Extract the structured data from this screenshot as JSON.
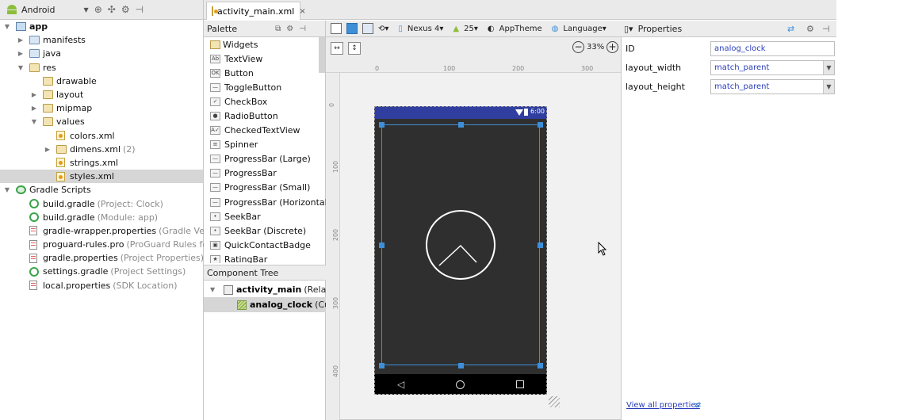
{
  "project_panel": {
    "view_label": "Android",
    "tree": [
      {
        "label": "app",
        "hint": "",
        "level": 0,
        "arrow": "down",
        "icon": "module",
        "bold": true
      },
      {
        "label": "manifests",
        "hint": "",
        "level": 1,
        "arrow": "right",
        "icon": "folder"
      },
      {
        "label": "java",
        "hint": "",
        "level": 1,
        "arrow": "right",
        "icon": "folder"
      },
      {
        "label": "res",
        "hint": "",
        "level": 1,
        "arrow": "down",
        "icon": "folder-res"
      },
      {
        "label": "drawable",
        "hint": "",
        "level": 2,
        "arrow": "",
        "icon": "folder-res"
      },
      {
        "label": "layout",
        "hint": "",
        "level": 2,
        "arrow": "right",
        "icon": "folder-res"
      },
      {
        "label": "mipmap",
        "hint": "",
        "level": 2,
        "arrow": "right",
        "icon": "folder-res"
      },
      {
        "label": "values",
        "hint": "",
        "level": 2,
        "arrow": "down",
        "icon": "folder-res"
      },
      {
        "label": "colors.xml",
        "hint": "",
        "level": 3,
        "arrow": "",
        "icon": "xml"
      },
      {
        "label": "dimens.xml",
        "hint": "(2)",
        "level": 3,
        "arrow": "right",
        "icon": "folder-res"
      },
      {
        "label": "strings.xml",
        "hint": "",
        "level": 3,
        "arrow": "",
        "icon": "xml"
      },
      {
        "label": "styles.xml",
        "hint": "",
        "level": 3,
        "arrow": "",
        "icon": "xml",
        "selected": true
      },
      {
        "label": "Gradle Scripts",
        "hint": "",
        "level": 0,
        "arrow": "down",
        "icon": "gradle-root"
      },
      {
        "label": "build.gradle",
        "hint": "(Project: Clock)",
        "level": 1,
        "arrow": "",
        "icon": "gradle"
      },
      {
        "label": "build.gradle",
        "hint": "(Module: app)",
        "level": 1,
        "arrow": "",
        "icon": "gradle"
      },
      {
        "label": "gradle-wrapper.properties",
        "hint": "(Gradle Version)",
        "level": 1,
        "arrow": "",
        "icon": "props"
      },
      {
        "label": "proguard-rules.pro",
        "hint": "(ProGuard Rules for app)",
        "level": 1,
        "arrow": "",
        "icon": "props"
      },
      {
        "label": "gradle.properties",
        "hint": "(Project Properties)",
        "level": 1,
        "arrow": "",
        "icon": "props"
      },
      {
        "label": "settings.gradle",
        "hint": "(Project Settings)",
        "level": 1,
        "arrow": "",
        "icon": "gradle"
      },
      {
        "label": "local.properties",
        "hint": "(SDK Location)",
        "level": 1,
        "arrow": "",
        "icon": "props"
      }
    ]
  },
  "editor_tab": {
    "label": "activity_main.xml",
    "close": "×"
  },
  "palette": {
    "title": "Palette",
    "items": [
      {
        "label": "Widgets",
        "icon": "",
        "category": true
      },
      {
        "label": "TextView",
        "icon": "Ab"
      },
      {
        "label": "Button",
        "icon": "OK"
      },
      {
        "label": "ToggleButton",
        "icon": "—"
      },
      {
        "label": "CheckBox",
        "icon": "✓"
      },
      {
        "label": "RadioButton",
        "icon": "●"
      },
      {
        "label": "CheckedTextView",
        "icon": "A✓"
      },
      {
        "label": "Spinner",
        "icon": "≡"
      },
      {
        "label": "ProgressBar (Large)",
        "icon": "—"
      },
      {
        "label": "ProgressBar",
        "icon": "—"
      },
      {
        "label": "ProgressBar (Small)",
        "icon": "—"
      },
      {
        "label": "ProgressBar (Horizontal)",
        "icon": "—"
      },
      {
        "label": "SeekBar",
        "icon": "•"
      },
      {
        "label": "SeekBar (Discrete)",
        "icon": "•"
      },
      {
        "label": "QuickContactBadge",
        "icon": "▣"
      },
      {
        "label": "RatingBar",
        "icon": "★"
      }
    ]
  },
  "component_tree": {
    "title": "Component Tree",
    "root": {
      "label": "activity_main",
      "hint": "(RelativeLa"
    },
    "child": {
      "label": "analog_clock",
      "hint": "(Custor"
    }
  },
  "design_toolbar": {
    "device": "Nexus 4",
    "api": "25",
    "theme": "AppTheme",
    "language": "Language"
  },
  "canvas": {
    "zoom": "33%",
    "ruler_top": [
      "0",
      "100",
      "200",
      "300"
    ],
    "ruler_left": [
      "0",
      "100",
      "200",
      "300",
      "400"
    ],
    "status_time": "6:00"
  },
  "properties": {
    "title": "Properties",
    "fields": [
      {
        "name": "ID",
        "value": "analog_clock",
        "kind": "input"
      },
      {
        "name": "layout_width",
        "value": "match_parent",
        "kind": "select"
      },
      {
        "name": "layout_height",
        "value": "match_parent",
        "kind": "select"
      }
    ],
    "view_all": "View all properties"
  },
  "colors": {
    "status_bar": "#303f9f",
    "selection": "#3e8fd8",
    "device_bg": "#2f2f2f",
    "link": "#2a3dbd"
  }
}
